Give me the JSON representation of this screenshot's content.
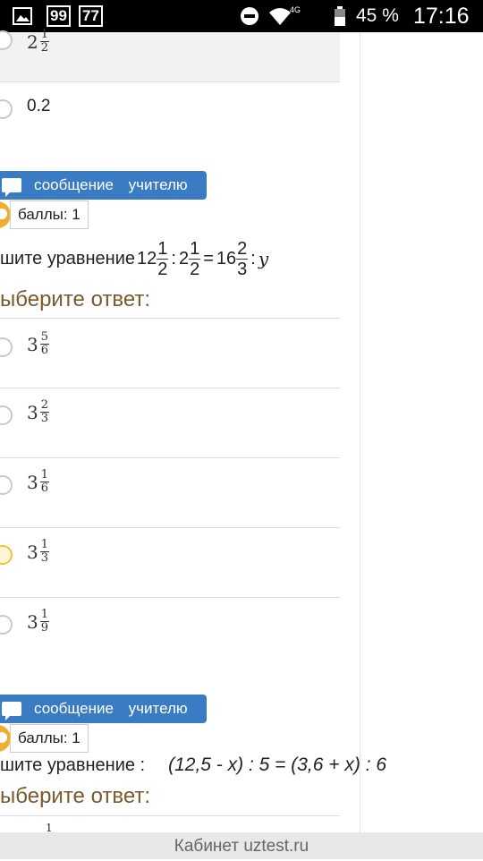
{
  "statusbar": {
    "badge1": "99",
    "badge2": "77",
    "network": "4G",
    "battery": "45 %",
    "time": "17:16"
  },
  "prev_options": [
    {
      "whole": "2",
      "num": "1",
      "den": "2"
    },
    {
      "text": "0.2"
    }
  ],
  "q1": {
    "message_button": "сообщение учителю",
    "score": "баллы: 1",
    "text": "шите уравнение",
    "expr": {
      "a_whole": "12",
      "a_num": "1",
      "a_den": "2",
      "op1": ":",
      "b_whole": "2",
      "b_num": "1",
      "b_den": "2",
      "eq": "=",
      "c_whole": "16",
      "c_num": "2",
      "c_den": "3",
      "op2": ":",
      "var": "y"
    },
    "prompt": "ыберите ответ:",
    "options": [
      {
        "whole": "3",
        "num": "5",
        "den": "6",
        "selected": false
      },
      {
        "whole": "3",
        "num": "2",
        "den": "3",
        "selected": false
      },
      {
        "whole": "3",
        "num": "1",
        "den": "6",
        "selected": false
      },
      {
        "whole": "3",
        "num": "1",
        "den": "3",
        "selected": true
      },
      {
        "whole": "3",
        "num": "1",
        "den": "9",
        "selected": false
      }
    ]
  },
  "q2": {
    "message_button": "сообщение учителю",
    "score": "баллы: 1",
    "text": "шите уравнение :",
    "expr": "(12,5 - x) : 5 = (3,6 + x) : 6",
    "prompt": "ыберите ответ:",
    "next_option_partial": "1"
  },
  "footer": "Кабинет uztest.ru"
}
